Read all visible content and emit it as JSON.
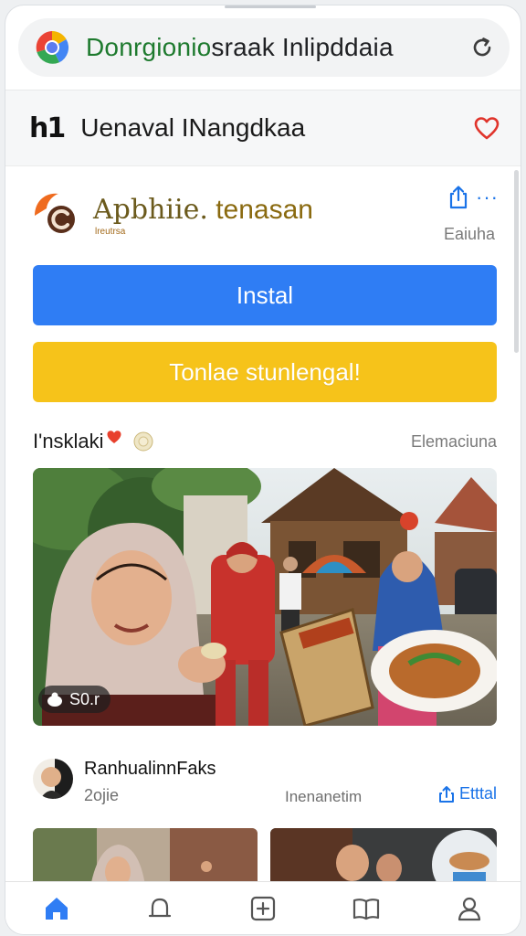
{
  "browser": {
    "url_green": "Donrgionio",
    "url_dark": "sraak Inlipddaia",
    "reload_icon": "reload-icon"
  },
  "site": {
    "logo_text": "h1",
    "name": "Uenaval INangdkaa",
    "heart_icon": "heart-outline-icon"
  },
  "app": {
    "title_first": "Apbhiie.",
    "title_rest": " tenasan",
    "subtitle": "lreutrsa",
    "side_label": "Eaiuha",
    "share_icon": "share-icon",
    "more_icon": "more-dots-icon",
    "more_dots": "···"
  },
  "buttons": {
    "install": "Instal",
    "secondary": "Tonlae stunlengal!"
  },
  "section": {
    "title": "I'nsklaki",
    "link": "Elemaciuna"
  },
  "image": {
    "view_count": "S0.r"
  },
  "author": {
    "name": "RanhualinnFaks",
    "meta": "2ojie",
    "middle": "Inenanetim",
    "action": "Etttal"
  },
  "nav": {
    "items": [
      {
        "icon": "home-icon"
      },
      {
        "icon": "bell-icon"
      },
      {
        "icon": "add-square-icon"
      },
      {
        "icon": "book-icon"
      },
      {
        "icon": "profile-icon"
      }
    ]
  },
  "colors": {
    "primary_blue": "#2f7df4",
    "accent_yellow": "#f6c31a",
    "link_blue": "#1a73e8"
  }
}
